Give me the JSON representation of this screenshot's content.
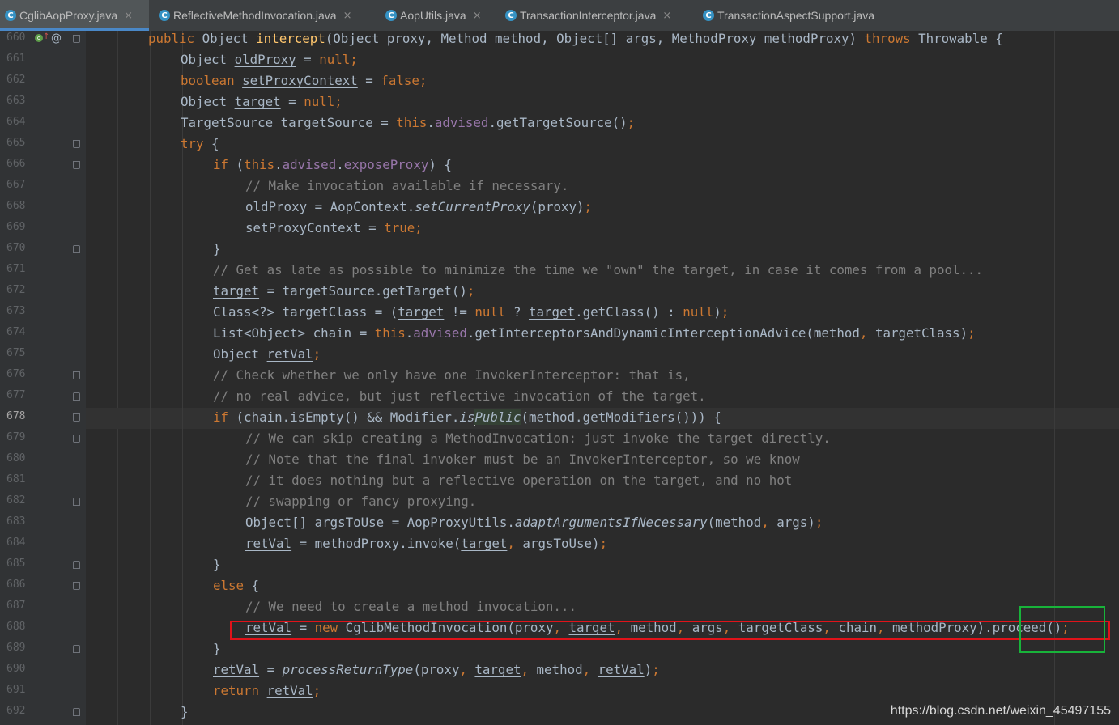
{
  "tabs": [
    {
      "label": "CglibAopProxy.java",
      "close": "×"
    },
    {
      "label": "ReflectiveMethodInvocation.java",
      "close": "×"
    },
    {
      "label": "AopUtils.java",
      "close": "×"
    },
    {
      "label": "TransactionInterceptor.java",
      "close": "×"
    },
    {
      "label": "TransactionAspectSupport.java",
      "close": ""
    }
  ],
  "file_icon_letter": "C",
  "gutter": {
    "line_numbers": [
      "660",
      "661",
      "662",
      "663",
      "664",
      "665",
      "666",
      "667",
      "668",
      "669",
      "670",
      "671",
      "672",
      "673",
      "674",
      "675",
      "676",
      "677",
      "678",
      "679",
      "680",
      "681",
      "682",
      "683",
      "684",
      "685",
      "686",
      "687",
      "688",
      "689",
      "690",
      "691",
      "692"
    ],
    "current_line": "678",
    "override_marker": "o",
    "override_arrow": "↑",
    "annotation_marker": "@"
  },
  "code": {
    "l660": {
      "public": "public",
      "type": " Object ",
      "name": "intercept",
      "params": "(Object proxy, Method method, Object[] args, MethodProxy methodProxy) ",
      "throws": "throws",
      "tail": " Throwable {"
    },
    "l661": {
      "a": "Object ",
      "v": "oldProxy",
      "b": " = ",
      "kw": "null",
      "c": ";"
    },
    "l662": {
      "kw1": "boolean ",
      "v": "setProxyContext",
      "b": " = ",
      "kw": "false",
      "c": ";"
    },
    "l663": {
      "a": "Object ",
      "v": "target",
      "b": " = ",
      "kw": "null",
      "c": ";"
    },
    "l664": {
      "a": "TargetSource targetSource = ",
      "kw": "this",
      "dot": ".",
      "fld": "advised",
      "c": ".getTargetSource()",
      "semi": ";"
    },
    "l665": {
      "kw": "try",
      "c": " {"
    },
    "l666": {
      "kw": "if",
      "a": " (",
      "kw2": "this",
      "dot": ".",
      "fld": "advised",
      "dot2": ".",
      "fld2": "exposeProxy",
      "c": ") {"
    },
    "l667": {
      "cm": "// Make invocation available if necessary."
    },
    "l668": {
      "v": "oldProxy",
      "a": " = AopContext.",
      "st": "setCurrentProxy",
      "c": "(proxy)",
      "semi": ";"
    },
    "l669": {
      "v": "setProxyContext",
      "b": " = ",
      "kw": "true",
      "c": ";"
    },
    "l670": {
      "c": "}"
    },
    "l671": {
      "cm": "// Get as late as possible to minimize the time we \"own\" the target, in case it comes from a pool..."
    },
    "l672": {
      "v": "target",
      "a": " = targetSource.getTarget()",
      "semi": ";"
    },
    "l673": {
      "a": "Class<?> targetClass = (",
      "v": "target",
      "b": " != ",
      "kw": "null",
      "c": " ? ",
      "v2": "target",
      "d": ".getClass() : ",
      "kw2": "null",
      "e": ")",
      "semi": ";"
    },
    "l674": {
      "a": "List<Object> chain = ",
      "kw": "this",
      "dot": ".",
      "fld": "advised",
      "c": ".getInterceptorsAndDynamicInterceptionAdvice(method",
      "comma": ", ",
      "d": "targetClass)",
      "semi": ";"
    },
    "l675": {
      "a": "Object ",
      "v": "retVal",
      "semi": ";"
    },
    "l676": {
      "cm": "// Check whether we only have one InvokerInterceptor: that is,"
    },
    "l677": {
      "cm": "// no real advice, but just reflective invocation of the target."
    },
    "l678": {
      "kw": "if",
      "a": " (chain.isEmpty() && Modifier.",
      "st1": "is",
      "st2": "Public",
      "c": "(method.getModifiers())) {"
    },
    "l679": {
      "cm": "// We can skip creating a MethodInvocation: just invoke the target directly."
    },
    "l680": {
      "cm": "// Note that the final invoker must be an InvokerInterceptor, so we know"
    },
    "l681": {
      "cm": "// it does nothing but a reflective operation on the target, and no hot"
    },
    "l682": {
      "cm": "// swapping or fancy proxying."
    },
    "l683": {
      "a": "Object[] argsToUse = AopProxyUtils.",
      "st": "adaptArgumentsIfNecessary",
      "c": "(method",
      "comma": ", ",
      "d": "args)",
      "semi": ";"
    },
    "l684": {
      "v": "retVal",
      "a": " = methodProxy.invoke(",
      "v2": "target",
      "comma": ", ",
      "d": "argsToUse)",
      "semi": ";"
    },
    "l685": {
      "c": "}"
    },
    "l686": {
      "kw": "else",
      "c": " {"
    },
    "l687": {
      "cm": "// We need to create a method invocation..."
    },
    "l688": {
      "v": "retVal",
      "a": " = ",
      "kw": "new",
      "b": " CglibMethodInvocation(proxy",
      "c1": ", ",
      "v2": "target",
      "c2": ", ",
      "m": "method",
      "c3": ", ",
      "ar": "args",
      "c4": ", ",
      "tc": "targetClass",
      "c5": ", ",
      "ch": "chain",
      "c6": ", ",
      "mp": "methodProxy).proceed()",
      "semi": ";"
    },
    "l689": {
      "c": "}"
    },
    "l690": {
      "v": "retVal",
      "a": " = ",
      "st": "processReturnType",
      "b": "(proxy",
      "c1": ", ",
      "v2": "target",
      "c2": ", ",
      "m": "method",
      "c3": ", ",
      "v3": "retVal",
      "d": ")",
      "semi": ";"
    },
    "l691": {
      "kw": "return",
      "b": " ",
      "v": "retVal",
      "semi": ";"
    },
    "l692": {
      "c": "}"
    }
  },
  "watermark": "https://blog.csdn.net/weixin_45497155",
  "colors": {
    "background": "#2b2b2b",
    "keyword": "#cc7832",
    "method_decl": "#ffc66d",
    "field": "#9876aa",
    "comment": "#808080",
    "text": "#a9b7c6",
    "annotation_red": "#e0131a",
    "annotation_green": "#18b33a"
  }
}
